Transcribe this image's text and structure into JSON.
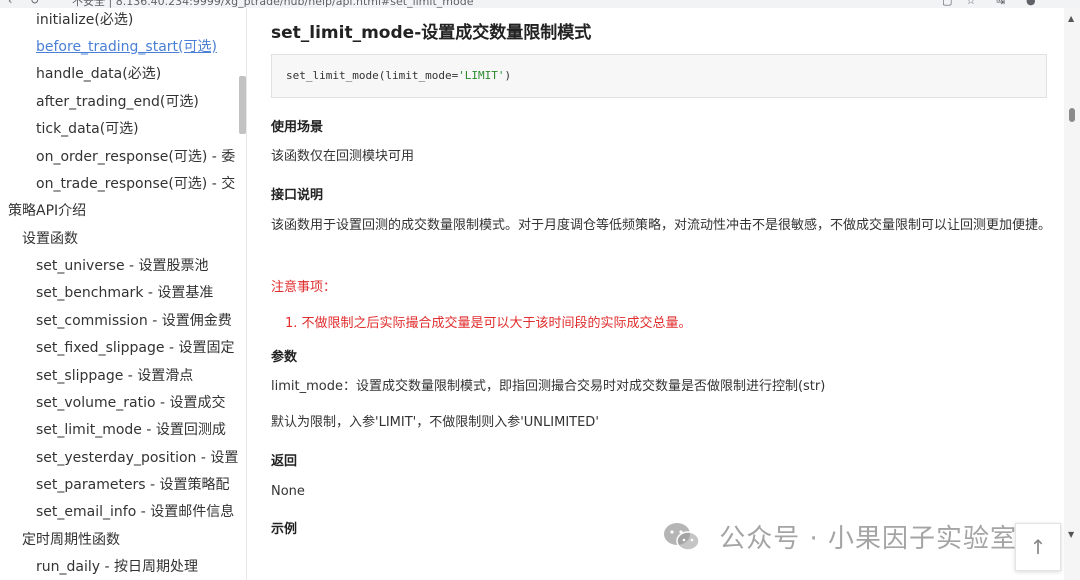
{
  "browser": {
    "url": "不安全 | 8.136.40.234:9999/xg_ptrade/hub/help/api.html#set_limit_mode"
  },
  "sidebar": {
    "items": [
      {
        "label": "initialize(必选)"
      },
      {
        "label": "before_trading_start(可选)"
      },
      {
        "label": "handle_data(必选)"
      },
      {
        "label": "after_trading_end(可选)"
      },
      {
        "label": "tick_data(可选)"
      },
      {
        "label": "on_order_response(可选) - 委"
      },
      {
        "label": "on_trade_response(可选) - 交"
      },
      {
        "label": "策略API介绍"
      },
      {
        "label": "设置函数"
      },
      {
        "label": "set_universe - 设置股票池"
      },
      {
        "label": "set_benchmark - 设置基准"
      },
      {
        "label": "set_commission - 设置佣金费"
      },
      {
        "label": "set_fixed_slippage - 设置固定"
      },
      {
        "label": "set_slippage - 设置滑点"
      },
      {
        "label": "set_volume_ratio - 设置成交"
      },
      {
        "label": "set_limit_mode - 设置回测成"
      },
      {
        "label": "set_yesterday_position - 设置"
      },
      {
        "label": "set_parameters - 设置策略配"
      },
      {
        "label": "set_email_info - 设置邮件信息"
      },
      {
        "label": "定时周期性函数"
      },
      {
        "label": "run_daily - 按日周期处理"
      }
    ]
  },
  "doc": {
    "title": "set_limit_mode-设置成交数量限制模式",
    "code": {
      "prefix": "set_limit_mode(limit_mode=",
      "string": "'LIMIT'",
      "suffix": ")"
    },
    "usage_heading": "使用场景",
    "usage_text": "该函数仅在回测模块可用",
    "interface_heading": "接口说明",
    "interface_text": "该函数用于设置回测的成交数量限制模式。对于月度调仓等低频策略，对流动性冲击不是很敏感，不做成交量限制可以让回测更加便捷。",
    "notes_heading": "注意事项：",
    "notes": [
      "1. 不做限制之后实际撮合成交量是可以大于该时间段的实际成交总量。"
    ],
    "params_heading": "参数",
    "param_text": "limit_mode：设置成交数量限制模式，即指回测撮合交易时对成交数量是否做限制进行控制(str)",
    "default_text": "默认为限制，入参'LIMIT'，不做限制则入参'UNLIMITED'",
    "return_heading": "返回",
    "return_text": "None",
    "example_heading": "示例"
  },
  "watermark": {
    "text": "公众号 · 小果因子实验室",
    "icon": "wechat-icon"
  },
  "back_to_top": {
    "icon": "arrow-up-icon",
    "glyph": "↑"
  },
  "colors": {
    "link_active": "#4a7fd6",
    "note_red": "#e02d2d",
    "code_string": "#2a8a2a"
  }
}
